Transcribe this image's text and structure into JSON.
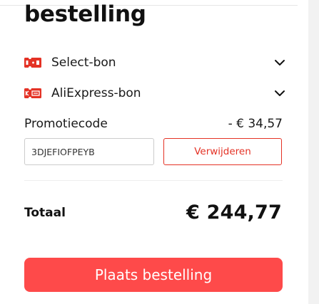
{
  "summary": {
    "heading": "bestelling"
  },
  "coupons": [
    {
      "label": "Select-bon",
      "icon": "select-coupon-icon",
      "expanded": false
    },
    {
      "label": "AliExpress-bon",
      "icon": "aliexpress-coupon-icon",
      "expanded": false
    }
  ],
  "promo": {
    "label": "Promotiecode",
    "discount": "- € 34,57",
    "code_value": "3DJEFIOFPEYB",
    "remove_label": "Verwijderen"
  },
  "total": {
    "label": "Totaal",
    "amount": "€ 244,77"
  },
  "actions": {
    "place_order_label": "Plaats bestelling"
  },
  "colors": {
    "accent": "#fe4a4a",
    "remove_border": "#e43225",
    "coupon_icon": "#e43225"
  }
}
